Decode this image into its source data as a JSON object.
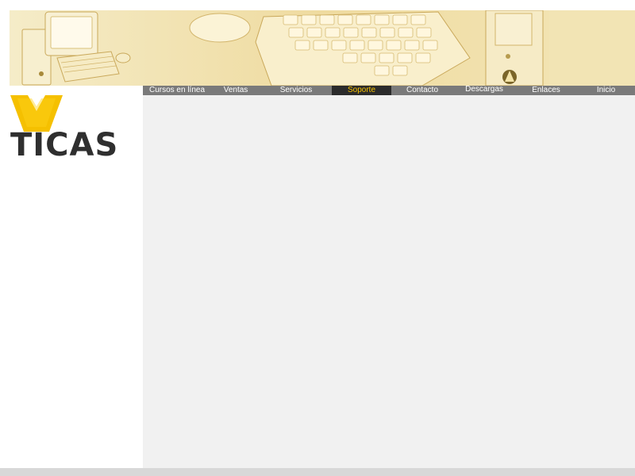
{
  "colors": {
    "accent": "#f5c000",
    "nav_background": "#7a7a7a",
    "nav_active_background": "#2b2b2b",
    "content_background": "#f1f1f1",
    "logo_dark": "#2f2f2f"
  },
  "logo": {
    "text": "TICAS"
  },
  "nav": {
    "items": [
      {
        "label": "Cursos en línea"
      },
      {
        "label": "Ventas"
      },
      {
        "label": "Servicios"
      },
      {
        "label": "Soporte",
        "active": true
      },
      {
        "label": "Contacto"
      },
      {
        "label": "Descargas"
      },
      {
        "label": "Enlaces"
      },
      {
        "label": "Inicio"
      }
    ]
  }
}
